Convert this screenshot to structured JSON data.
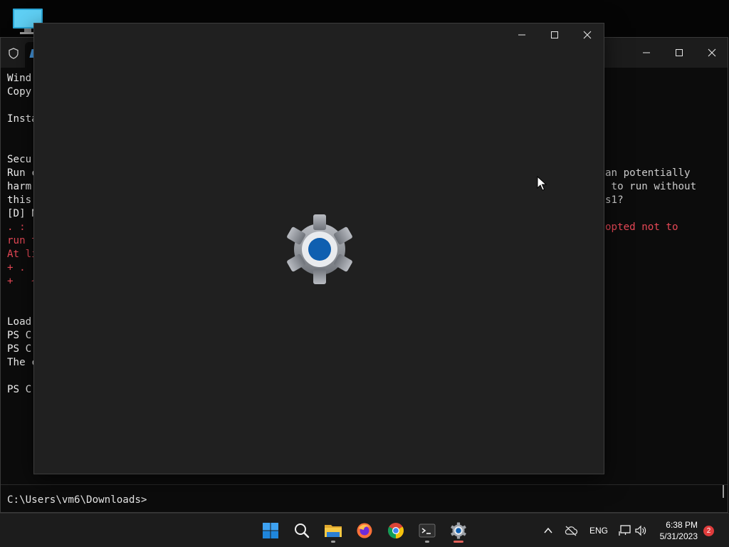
{
  "desktop": {
    "icon": "this-pc-icon"
  },
  "terminal": {
    "icons": {
      "shield": "shield-icon",
      "minimize": "minimize-icon",
      "maximize": "maximize-icon",
      "close": "close-icon"
    },
    "lines_left": [
      {
        "text": "Wind",
        "color": "white"
      },
      {
        "text": "Copy",
        "color": "white"
      },
      {
        "text": "",
        "color": "white"
      },
      {
        "text": "Insta",
        "color": "white"
      },
      {
        "text": "",
        "color": "white"
      },
      {
        "text": "",
        "color": "white"
      },
      {
        "text": "Secu",
        "color": "white"
      },
      {
        "text": "Run c",
        "color": "white"
      },
      {
        "text": "harm",
        "color": "white"
      },
      {
        "text": "this",
        "color": "white"
      },
      {
        "text": "[D] N",
        "color": "white"
      },
      {
        "text": ". : (",
        "color": "red"
      },
      {
        "text": "run t",
        "color": "red"
      },
      {
        "text": "At li",
        "color": "red"
      },
      {
        "text": "+ .",
        "color": "red"
      },
      {
        "text": "+   ~",
        "color": "red"
      },
      {
        "text": "    ",
        "color": "red"
      },
      {
        "text": "",
        "color": "white"
      },
      {
        "text": "Load",
        "color": "white"
      },
      {
        "text": "PS C",
        "color": "white"
      },
      {
        "text": "PS C",
        "color": "white"
      },
      {
        "text": "The c",
        "color": "white"
      },
      {
        "text": "",
        "color": "white"
      },
      {
        "text": "PS C",
        "color": "white"
      }
    ],
    "lines_right": [
      {
        "text": "an potentially",
        "color": "white"
      },
      {
        "text": " to run without",
        "color": "white"
      },
      {
        "text": "s1?",
        "color": "white"
      },
      {
        "text": "",
        "color": "white"
      },
      {
        "text": "opted not to",
        "color": "red"
      }
    ],
    "prompt": "C:\\Users\\vm6\\Downloads>"
  },
  "settings_window": {
    "icons": {
      "minimize": "minimize-icon",
      "maximize": "maximize-icon",
      "close": "close-icon",
      "logo": "settings-gear-icon"
    }
  },
  "taskbar": {
    "apps": [
      {
        "name": "start-button",
        "icon": "windows-logo-icon"
      },
      {
        "name": "search-button",
        "icon": "search-icon"
      },
      {
        "name": "file-explorer-button",
        "icon": "folder-icon"
      },
      {
        "name": "firefox-button",
        "icon": "firefox-icon"
      },
      {
        "name": "chrome-button",
        "icon": "chrome-icon"
      },
      {
        "name": "terminal-button",
        "icon": "terminal-icon"
      },
      {
        "name": "settings-button",
        "icon": "settings-gear-icon"
      }
    ],
    "tray": {
      "language": "ENG",
      "time": "6:38 PM",
      "date": "5/31/2023",
      "notification_count": "2"
    }
  },
  "colors": {
    "accent": "#0067c0",
    "error_text": "#e74856",
    "taskbar": "#1c1c1c",
    "settings_bg": "#202020"
  }
}
